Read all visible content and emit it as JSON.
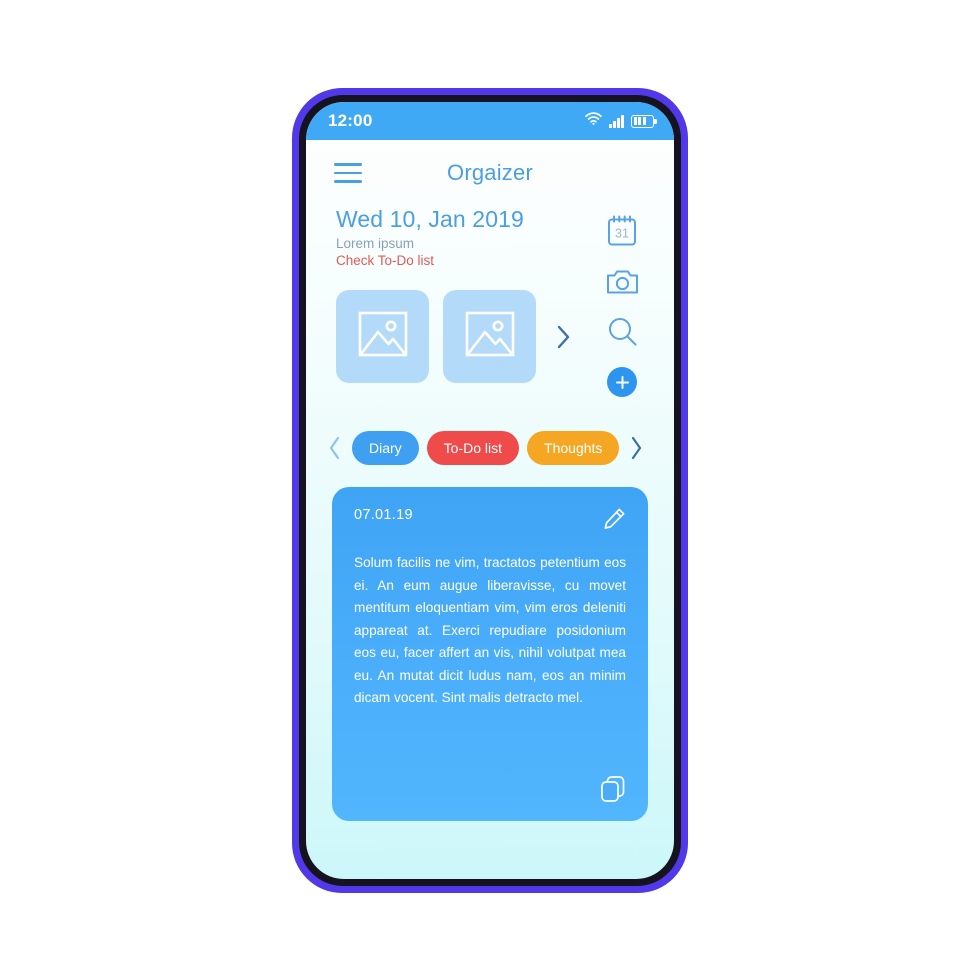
{
  "status_bar": {
    "time": "12:00",
    "icons": [
      "wifi-icon",
      "cellular-signal-icon",
      "battery-icon"
    ]
  },
  "app_bar": {
    "menu_icon": "hamburger-menu-icon",
    "title": "Orgaizer"
  },
  "date_block": {
    "date": "Wed 10, Jan 2019",
    "subtitle": "Lorem ipsum",
    "alert": "Check To-Do list"
  },
  "action_rail": {
    "items": [
      {
        "name": "calendar-icon",
        "label": "31"
      },
      {
        "name": "camera-icon",
        "label": ""
      },
      {
        "name": "search-icon",
        "label": ""
      },
      {
        "name": "add-button",
        "label": "+"
      }
    ]
  },
  "gallery": {
    "thumbnails": [
      {
        "icon": "image-placeholder-icon"
      },
      {
        "icon": "image-placeholder-icon"
      }
    ],
    "next_icon": "chevron-right-icon"
  },
  "tabs": {
    "prev_icon": "chevron-left-icon",
    "next_icon": "chevron-right-icon",
    "items": [
      {
        "label": "Diary",
        "color": "#3fa0f2"
      },
      {
        "label": "To-Do list",
        "color": "#ef4b4b"
      },
      {
        "label": "Thoughts",
        "color": "#f5a623"
      }
    ]
  },
  "entry_card": {
    "date": "07.01.19",
    "edit_icon": "pencil-edit-icon",
    "copy_icon": "copy-icon",
    "text": "Solum facilis ne vim, tractatos petentium eos ei. An eum augue liberavisse, cu movet mentitum eloquentiam vim, vim eros deleniti appareat at. Exerci repudiare posidonium eos eu, facer affert an vis, nihil volutpat mea eu. An mutat dicit ludus nam, eos an minim dicam vocent. Sint malis detracto mel."
  },
  "colors": {
    "frame": "#5138e8",
    "bezel": "#151320",
    "status_bar": "#3fa9f5",
    "accent_blue": "#4a9fe0",
    "card_blue": "#44a8f7",
    "alert_red": "#e05a56",
    "thumb_blue": "#b3daf9",
    "screen_bottom": "#ccf7fa"
  }
}
